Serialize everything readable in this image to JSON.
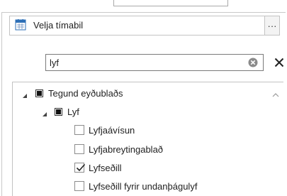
{
  "time_period": {
    "label": "Velja tímabil",
    "more_label": "···"
  },
  "search": {
    "value": "lyf"
  },
  "tree": {
    "root": {
      "label": "Tegund eyðublaðs"
    },
    "group": {
      "label": "Lyf"
    },
    "items": [
      {
        "label": "Lyfjaávísun",
        "checked": false
      },
      {
        "label": "Lyfjabreytingablað",
        "checked": false
      },
      {
        "label": "Lyfseðill",
        "checked": true
      },
      {
        "label": "Lyfseðill fyrir undanþágulyf",
        "checked": false
      }
    ]
  },
  "icons": [
    "calendar-icon",
    "more-options-icon",
    "clear-search-icon",
    "close-icon",
    "collapse-icon",
    "partial-check-icon",
    "checkmark-icon",
    "scroll-up-icon"
  ]
}
